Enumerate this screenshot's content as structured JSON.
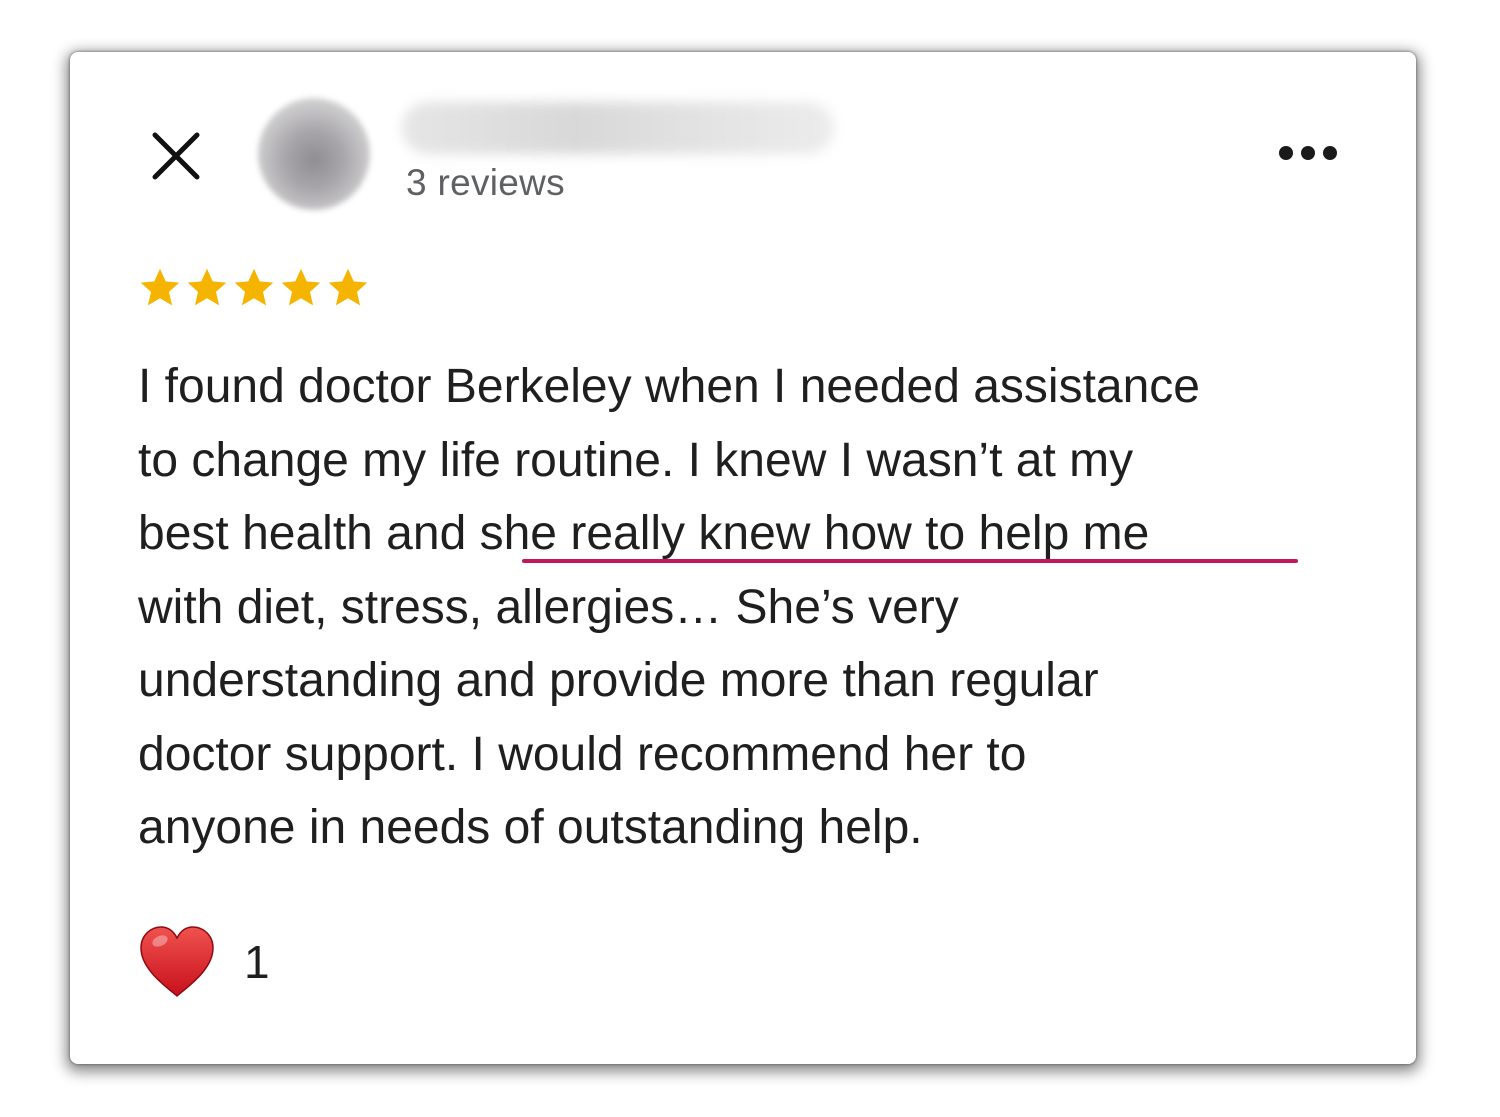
{
  "header": {
    "close_icon": "close-icon",
    "reviewer_review_count": "3 reviews",
    "more_icon": "more-horizontal-icon"
  },
  "rating": {
    "stars": 5,
    "max_stars": 5,
    "color": "#F5B400"
  },
  "review": {
    "lines": [
      "I found doctor Berkeley when I needed assistance",
      "to change my life routine. I knew I wasn’t at my",
      "best health and ",
      "she really knew how to help me",
      "with diet, stress, allergies… She’s very",
      "understanding and provide more than regular",
      "doctor support. I would recommend her to",
      "anyone in needs of outstanding help."
    ],
    "highlight_color": "#C2185B"
  },
  "reaction": {
    "icon": "heart-icon",
    "count": "1",
    "color": "#E0242B"
  }
}
